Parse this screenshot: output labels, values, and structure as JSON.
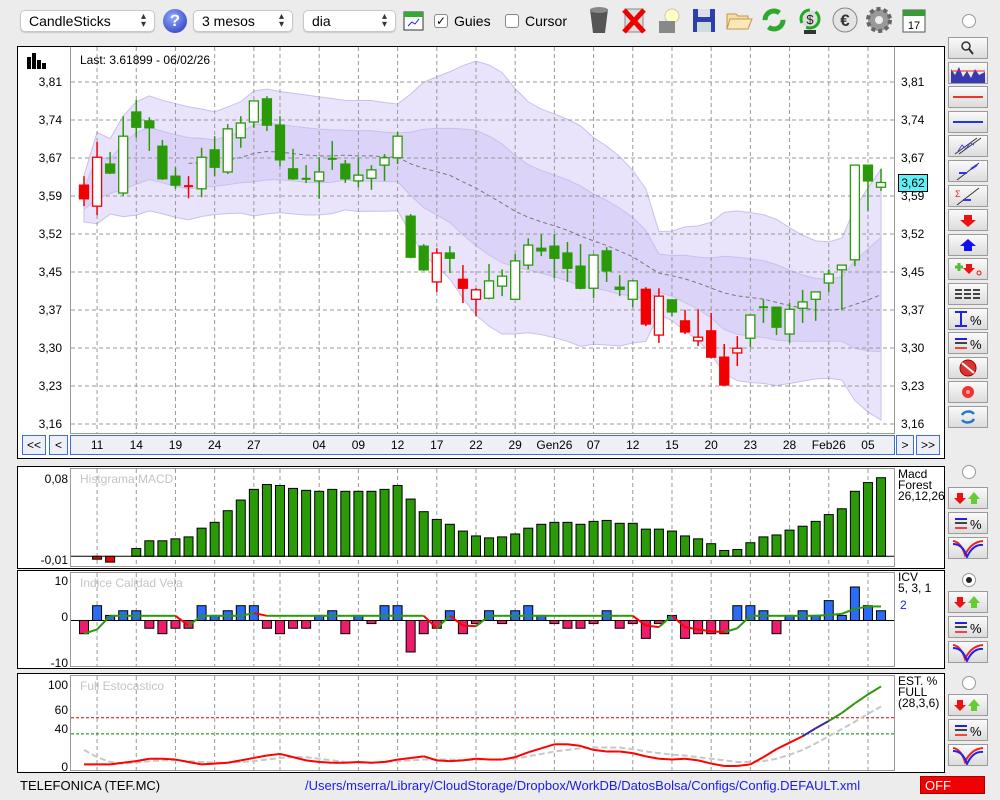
{
  "toolbar": {
    "chart_type": "CandleSticks",
    "period": "3 mesos",
    "interval": "dia",
    "guides_label": "Guies",
    "guides_checked": true,
    "cursor_label": "Cursor",
    "cursor_checked": false,
    "icons": [
      "help-icon",
      "chart-settings-icon",
      "trash-icon",
      "delete-x-icon",
      "lamp-icon",
      "save-icon",
      "folder-icon",
      "refresh-icon",
      "currency-refresh-icon",
      "euro-icon",
      "gear-icon",
      "calendar-icon"
    ],
    "calendar_day": "17"
  },
  "price_panel": {
    "last_label": "Last: 3.61899 - 06/02/26",
    "current_price_tag": "3,62",
    "y_ticks": [
      "3,81",
      "3,74",
      "3,67",
      "3,59",
      "3,52",
      "3,45",
      "3,37",
      "3,30",
      "3,23",
      "3,16"
    ],
    "nav": {
      "first": "<<",
      "prev": "<",
      "next": ">",
      "last": ">>"
    },
    "extra_gridlines": [
      16
    ]
  },
  "macd_panel": {
    "title": "Histgrama MACD",
    "y_ticks": [
      "0,08",
      "-0,01"
    ],
    "label_lines": [
      "Macd",
      "Forest",
      "26,12,26"
    ]
  },
  "icv_panel": {
    "title": "Indice Calidad Vela",
    "y_ticks": [
      "10",
      "0",
      "-10"
    ],
    "label_lines": [
      "ICV",
      "5, 3, 1"
    ],
    "value_label": "2"
  },
  "stoch_panel": {
    "title": "Full Estocastico",
    "y_ticks": [
      "100",
      "60",
      "40",
      "0"
    ],
    "label_lines": [
      "EST. %",
      "FULL",
      "(28,3,6)"
    ]
  },
  "footer": {
    "ticker": "TELEFONICA (TEF.MC)",
    "config_path": "/Users/mserra/Library/CloudStorage/Dropbox/WorkDB/DatosBolsa/Configs/Config.DEFAULT.xml",
    "status": "OFF"
  },
  "colors": {
    "up": "#2a9a08",
    "down": "#f00000",
    "band_outer": "#e9e4fc",
    "band_inner": "#dcd4f8",
    "icv_pos": "#2a6cf6",
    "icv_neg": "#ee1c6c",
    "price_tag": "#5ef0f6",
    "status_off": "#f00000",
    "link": "#1a1aee"
  },
  "chart_data": [
    {
      "type": "candlestick",
      "title": "CandleSticks",
      "ylim": [
        3.16,
        3.81
      ],
      "date_labels": [
        {
          "label": "11",
          "index": 2
        },
        {
          "label": "14",
          "index": 5
        },
        {
          "label": "19",
          "index": 8
        },
        {
          "label": "24",
          "index": 11
        },
        {
          "label": "27",
          "index": 14
        },
        {
          "label": "04",
          "index": 19
        },
        {
          "label": "09",
          "index": 22
        },
        {
          "label": "12",
          "index": 25
        },
        {
          "label": "17",
          "index": 28
        },
        {
          "label": "22",
          "index": 31
        },
        {
          "label": "29",
          "index": 34
        },
        {
          "label": "Gen26",
          "index": 37
        },
        {
          "label": "07",
          "index": 40
        },
        {
          "label": "12",
          "index": 43
        },
        {
          "label": "15",
          "index": 46
        },
        {
          "label": "20",
          "index": 49
        },
        {
          "label": "23",
          "index": 52
        },
        {
          "label": "28",
          "index": 55
        },
        {
          "label": "Feb26",
          "index": 58
        },
        {
          "label": "05",
          "index": 61
        }
      ],
      "ohlc": [
        [
          3.614,
          3.631,
          3.574,
          3.588
        ],
        [
          3.574,
          3.696,
          3.557,
          3.667
        ],
        [
          3.654,
          3.677,
          3.635,
          3.637
        ],
        [
          3.599,
          3.745,
          3.593,
          3.707
        ],
        [
          3.753,
          3.776,
          3.704,
          3.724
        ],
        [
          3.736,
          3.743,
          3.679,
          3.723
        ],
        [
          3.688,
          3.7,
          3.624,
          3.626
        ],
        [
          3.631,
          3.648,
          3.607,
          3.614
        ],
        [
          3.612,
          3.631,
          3.589,
          3.612
        ],
        [
          3.607,
          3.685,
          3.591,
          3.667
        ],
        [
          3.681,
          3.707,
          3.631,
          3.648
        ],
        [
          3.639,
          3.73,
          3.635,
          3.721
        ],
        [
          3.704,
          3.745,
          3.685,
          3.732
        ],
        [
          3.734,
          3.774,
          3.723,
          3.774
        ],
        [
          3.778,
          3.783,
          3.717,
          3.728
        ],
        [
          3.728,
          3.745,
          3.65,
          3.662
        ],
        [
          3.645,
          3.683,
          3.624,
          3.626
        ],
        [
          3.626,
          3.652,
          3.618,
          3.626
        ],
        [
          3.622,
          3.667,
          3.588,
          3.639
        ],
        [
          3.664,
          3.698,
          3.643,
          3.664
        ],
        [
          3.654,
          3.662,
          3.618,
          3.626
        ],
        [
          3.622,
          3.667,
          3.61,
          3.633
        ],
        [
          3.627,
          3.652,
          3.605,
          3.643
        ],
        [
          3.652,
          3.673,
          3.622,
          3.666
        ],
        [
          3.666,
          3.715,
          3.654,
          3.707
        ],
        [
          3.555,
          3.559,
          3.475,
          3.477
        ],
        [
          3.498,
          3.502,
          3.451,
          3.453
        ],
        [
          3.43,
          3.494,
          3.411,
          3.485
        ],
        [
          3.485,
          3.498,
          3.447,
          3.475
        ],
        [
          3.435,
          3.462,
          3.39,
          3.418
        ],
        [
          3.397,
          3.418,
          3.365,
          3.415
        ],
        [
          3.399,
          3.464,
          3.397,
          3.432
        ],
        [
          3.422,
          3.454,
          3.403,
          3.441
        ],
        [
          3.397,
          3.483,
          3.397,
          3.47
        ],
        [
          3.462,
          3.513,
          3.454,
          3.5
        ],
        [
          3.494,
          3.521,
          3.479,
          3.489
        ],
        [
          3.498,
          3.521,
          3.437,
          3.475
        ],
        [
          3.485,
          3.506,
          3.43,
          3.456
        ],
        [
          3.46,
          3.502,
          3.416,
          3.418
        ],
        [
          3.418,
          3.483,
          3.399,
          3.481
        ],
        [
          3.489,
          3.496,
          3.43,
          3.451
        ],
        [
          3.42,
          3.443,
          3.403,
          3.416
        ],
        [
          3.397,
          3.434,
          3.382,
          3.432
        ],
        [
          3.416,
          3.42,
          3.346,
          3.35
        ],
        [
          3.329,
          3.418,
          3.314,
          3.403
        ],
        [
          3.396,
          3.396,
          3.365,
          3.373
        ],
        [
          3.356,
          3.377,
          3.331,
          3.335
        ],
        [
          3.318,
          3.378,
          3.308,
          3.325
        ],
        [
          3.337,
          3.371,
          3.285,
          3.287
        ],
        [
          3.287,
          3.312,
          3.234,
          3.234
        ],
        [
          3.295,
          3.327,
          3.27,
          3.304
        ],
        [
          3.323,
          3.367,
          3.306,
          3.367
        ],
        [
          3.382,
          3.397,
          3.352,
          3.382
        ],
        [
          3.382,
          3.382,
          3.329,
          3.344
        ],
        [
          3.331,
          3.39,
          3.314,
          3.378
        ],
        [
          3.38,
          3.415,
          3.352,
          3.392
        ],
        [
          3.397,
          3.411,
          3.356,
          3.411
        ],
        [
          3.428,
          3.454,
          3.411,
          3.445
        ],
        [
          3.453,
          3.462,
          3.377,
          3.462
        ],
        [
          3.472,
          3.652,
          3.46,
          3.652
        ],
        [
          3.652,
          3.652,
          3.565,
          3.622
        ],
        [
          3.61,
          3.645,
          3.603,
          3.619
        ]
      ],
      "colors": [
        "red",
        "red",
        "green",
        "green",
        "green",
        "green",
        "green",
        "green",
        "red",
        "green",
        "green",
        "green",
        "green",
        "green",
        "green",
        "green",
        "green",
        "green",
        "green",
        "green",
        "green",
        "green",
        "green",
        "green",
        "green",
        "green",
        "green",
        "red",
        "green",
        "red",
        "red",
        "green",
        "green",
        "green",
        "green",
        "green",
        "green",
        "green",
        "green",
        "green",
        "green",
        "green",
        "green",
        "red",
        "red",
        "green",
        "red",
        "red",
        "red",
        "red",
        "red",
        "green",
        "green",
        "green",
        "green",
        "green",
        "green",
        "green",
        "green",
        "green",
        "green",
        "green"
      ]
    },
    {
      "type": "bar",
      "title": "Histgrama MACD",
      "ylim": [
        -0.01,
        0.09
      ],
      "values": [
        0,
        -0.003,
        -0.006,
        0,
        0.008,
        0.016,
        0.016,
        0.018,
        0.02,
        0.029,
        0.035,
        0.047,
        0.058,
        0.069,
        0.074,
        0.073,
        0.07,
        0.068,
        0.067,
        0.069,
        0.067,
        0.067,
        0.067,
        0.069,
        0.073,
        0.059,
        0.046,
        0.038,
        0.033,
        0.026,
        0.021,
        0.019,
        0.02,
        0.023,
        0.029,
        0.033,
        0.035,
        0.035,
        0.033,
        0.036,
        0.037,
        0.034,
        0.034,
        0.028,
        0.028,
        0.026,
        0.021,
        0.018,
        0.013,
        0.006,
        0.007,
        0.014,
        0.02,
        0.022,
        0.027,
        0.031,
        0.036,
        0.043,
        0.049,
        0.067,
        0.076,
        0.081
      ]
    },
    {
      "type": "bar",
      "title": "Indice Calidad Vela",
      "ylim": [
        -11.7,
        12.2
      ],
      "values": [
        -3.4,
        3.8,
        1.3,
        2.5,
        2.5,
        -2,
        -3.4,
        -2,
        -2,
        3.8,
        1.3,
        2.5,
        3.8,
        3.8,
        -2,
        -3.4,
        -2,
        -2,
        1.3,
        2.5,
        -3.4,
        1.3,
        -0.8,
        3.8,
        3.8,
        -8.1,
        -3.4,
        -2,
        2.5,
        -3.4,
        -0.8,
        2.5,
        -0.8,
        2.5,
        3.8,
        1.3,
        -0.8,
        -2,
        -2,
        -0.8,
        2.5,
        -2,
        -0.8,
        -4.6,
        -0.8,
        1.3,
        -4.6,
        -3.4,
        -3.4,
        -3.4,
        3.8,
        3.8,
        2.5,
        -3.4,
        1.3,
        2.5,
        1.3,
        5.1,
        1.3,
        8.6,
        3.8,
        2.5
      ],
      "signal": [
        -3.4,
        -2.3,
        1.2,
        1.2,
        1.2,
        1.2,
        1.2,
        1.2,
        -1.3,
        1.2,
        1.2,
        1.2,
        1.2,
        1.9,
        1.2,
        1.2,
        1.2,
        1.2,
        1.2,
        1.2,
        1.2,
        1.2,
        1.2,
        1.2,
        1.2,
        1.2,
        1.2,
        -2,
        1.2,
        -1.3,
        -1.5,
        1.2,
        1.2,
        1.2,
        1.2,
        1.2,
        1.2,
        1.2,
        1.2,
        1.2,
        1.2,
        1.2,
        1.2,
        -1.3,
        -1.7,
        1.2,
        -1.7,
        -2.3,
        -2.8,
        -3,
        -2,
        1.2,
        1.2,
        1.2,
        1.2,
        1.2,
        1.2,
        1.4,
        1.7,
        3,
        3.6,
        3.6
      ]
    },
    {
      "type": "line",
      "title": "Full Estocastico",
      "ylim": [
        -5,
        112
      ],
      "levels": [
        60,
        40
      ],
      "series": [
        {
          "name": "%K",
          "values": [
            2,
            2,
            2,
            4,
            6,
            9,
            9,
            8,
            5,
            2,
            3,
            4,
            7,
            10,
            13,
            15,
            11,
            7,
            5,
            4,
            4,
            5,
            4,
            5,
            8,
            10,
            12,
            7,
            6,
            7,
            9,
            8,
            8,
            11,
            17,
            22,
            27,
            27,
            25,
            20,
            18,
            18,
            16,
            12,
            9,
            8,
            9,
            7,
            3,
            0,
            0,
            2,
            11,
            21,
            29,
            37,
            47,
            56,
            66,
            78,
            89,
            99
          ]
        },
        {
          "name": "%D",
          "values": [
            20,
            11,
            5,
            3,
            4,
            6,
            7,
            7,
            6,
            5,
            4,
            4,
            5,
            6,
            8,
            10,
            11,
            11,
            9,
            7,
            5,
            4,
            4,
            5,
            6,
            7,
            8,
            8,
            8,
            7,
            8,
            8,
            8,
            9,
            12,
            15,
            18,
            20,
            22,
            23,
            23,
            23,
            21,
            18,
            16,
            14,
            13,
            11,
            9,
            7,
            5,
            5,
            6,
            9,
            14,
            20,
            28,
            37,
            46,
            55,
            65,
            74
          ]
        }
      ]
    }
  ]
}
